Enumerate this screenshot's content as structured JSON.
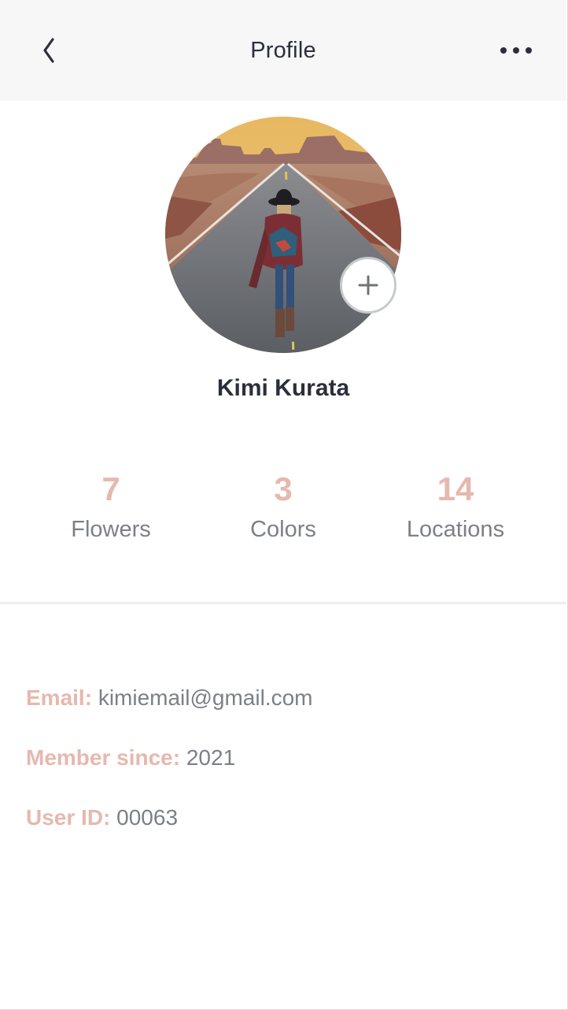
{
  "header": {
    "title": "Profile",
    "back_icon": "chevron-left-icon",
    "more_icon": "more-horizontal-icon"
  },
  "profile": {
    "name": "Kimi Kurata",
    "avatar_alt": "Woman walking on a desert road",
    "add_photo_icon": "plus-icon"
  },
  "stats": [
    {
      "value": "7",
      "label": "Flowers"
    },
    {
      "value": "3",
      "label": "Colors"
    },
    {
      "value": "14",
      "label": "Locations"
    }
  ],
  "info": {
    "email_label": "Email:",
    "email_value": "kimiemail@gmail.com",
    "member_label": "Member since:",
    "member_value": "2021",
    "userid_label": "User ID:",
    "userid_value": "00063"
  },
  "colors": {
    "accent": "#e6b8ae",
    "text_dark": "#2b2f3a",
    "text_muted": "#7c8086",
    "header_bg": "#f7f7f7"
  }
}
